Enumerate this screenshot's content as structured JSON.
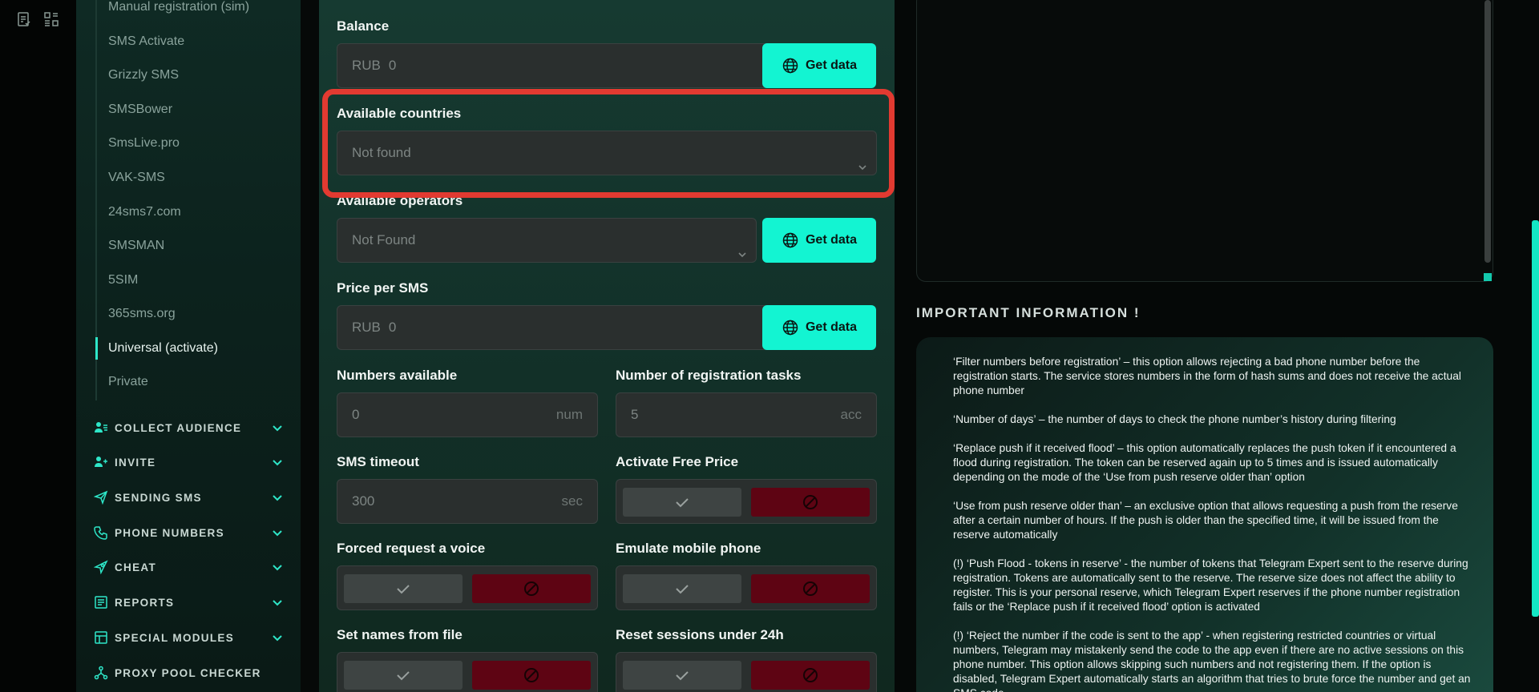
{
  "sidebar": {
    "sub_items": [
      {
        "label": "Manual registration (sim)",
        "active": false
      },
      {
        "label": "SMS Activate",
        "active": false
      },
      {
        "label": "Grizzly SMS",
        "active": false
      },
      {
        "label": "SMSBower",
        "active": false
      },
      {
        "label": "SmsLive.pro",
        "active": false
      },
      {
        "label": "VAK-SMS",
        "active": false
      },
      {
        "label": "24sms7.com",
        "active": false
      },
      {
        "label": "SMSMAN",
        "active": false
      },
      {
        "label": "5SIM",
        "active": false
      },
      {
        "label": "365sms.org",
        "active": false
      },
      {
        "label": "Universal (activate)",
        "active": true
      },
      {
        "label": "Private",
        "active": false
      }
    ],
    "sections": [
      {
        "label": "COLLECT AUDIENCE",
        "icon": "users-icon"
      },
      {
        "label": "INVITE",
        "icon": "user-plus-icon"
      },
      {
        "label": "SENDING SMS",
        "icon": "send-icon"
      },
      {
        "label": "PHONE NUMBERS",
        "icon": "phone-icon"
      },
      {
        "label": "CHEAT",
        "icon": "rocket-icon"
      },
      {
        "label": "REPORTS",
        "icon": "report-icon"
      },
      {
        "label": "SPECIAL MODULES",
        "icon": "modules-icon"
      },
      {
        "label": "PROXY POOL CHECKER",
        "icon": "network-icon"
      }
    ]
  },
  "form": {
    "balance": {
      "label": "Balance",
      "prefix": "RUB",
      "value": "0",
      "button": "Get data"
    },
    "countries": {
      "label": "Available countries",
      "value": "Not found"
    },
    "operators": {
      "label": "Available operators",
      "value": "Not Found",
      "button": "Get data"
    },
    "price": {
      "label": "Price per SMS",
      "prefix": "RUB",
      "value": "0",
      "button": "Get data"
    },
    "numbers_available": {
      "label": "Numbers available",
      "value": "0",
      "suffix": "num"
    },
    "reg_tasks": {
      "label": "Number of registration tasks",
      "value": "5",
      "suffix": "acc"
    },
    "sms_timeout": {
      "label": "SMS timeout",
      "value": "300",
      "suffix": "sec"
    },
    "free_price": {
      "label": "Activate Free Price"
    },
    "forced_voice": {
      "label": "Forced request a voice"
    },
    "emulate_mobile": {
      "label": "Emulate mobile phone"
    },
    "names_file": {
      "label": "Set names from file"
    },
    "reset_sessions": {
      "label": "Reset sessions under 24h"
    }
  },
  "info": {
    "title": "IMPORTANT INFORMATION !",
    "paragraphs": [
      "‘Filter numbers before registration’ – this option allows rejecting a bad phone number before the registration starts. The service stores numbers in the form of hash sums and does not receive the actual phone number",
      "‘Number of days’ – the number of days to check the phone number’s history during filtering",
      "‘Replace push if it received flood’ – this option automatically replaces the push token if it encountered a flood during registration. The token can be reserved again up to 5 times and is issued automatically depending on the mode of the ‘Use from push reserve older than’ option",
      "‘Use from push reserve older than’ – an exclusive option that allows requesting a push from the reserve after a certain number of hours. If the push is older than the specified time, it will be issued from the reserve automatically",
      "(!) ‘Push Flood - tokens in reserve’ - the number of tokens that Telegram Expert sent to the reserve during registration. Tokens are automatically sent to the reserve. The reserve size does not affect the ability to register. This is your personal reserve, which Telegram Expert reserves if the phone number registration fails or the ‘Replace push if it received flood’ option is activated",
      "(!) ‘Reject the number if the code is sent to the app’ - when registering restricted countries or virtual numbers, Telegram may mistakenly send the code to the app even if there are no active sessions on this phone number. This option allows skipping such numbers and not registering them. If the option is disabled, Telegram Expert automatically starts an algorithm that tries to brute force the number and get an SMS code"
    ]
  },
  "colors": {
    "accent": "#13f4d2",
    "danger": "#5e0413",
    "highlight": "#e23a31"
  }
}
